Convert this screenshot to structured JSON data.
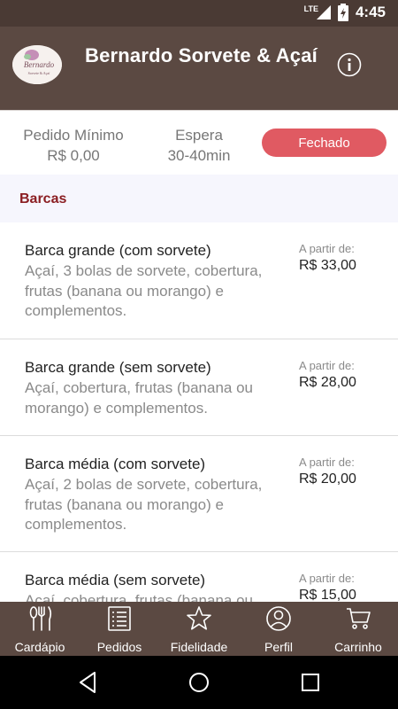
{
  "status_bar": {
    "network": "LTE",
    "time": "4:45"
  },
  "header": {
    "title": "Bernardo Sorvete & Açaí",
    "logo": {
      "name": "Bernardo",
      "sub": "Sorvete & Açaí"
    }
  },
  "info": {
    "min_order_label": "Pedido Mínimo",
    "min_order_value": "R$ 0,00",
    "wait_label": "Espera",
    "wait_value": "30-40min",
    "status": "Fechado"
  },
  "section": {
    "title": "Barcas"
  },
  "items": [
    {
      "name": "Barca grande (com sorvete)",
      "desc": "Açaí, 3 bolas de sorvete, cobertura, frutas (banana ou morango) e complementos.",
      "from": "A partir de:",
      "price": "R$ 33,00"
    },
    {
      "name": "Barca grande (sem sorvete)",
      "desc": "Açaí, cobertura, frutas (banana ou morango) e complementos.",
      "from": "A partir de:",
      "price": "R$ 28,00"
    },
    {
      "name": "Barca média (com sorvete)",
      "desc": "Açaí, 2 bolas de sorvete, cobertura, frutas (banana ou morango) e complementos.",
      "from": "A partir de:",
      "price": "R$ 20,00"
    },
    {
      "name": "Barca média (sem sorvete)",
      "desc": "Açaí, cobertura, frutas (banana ou morango) e complementos.",
      "from": "A partir de:",
      "price": "R$ 15,00"
    }
  ],
  "bottom_nav": [
    {
      "label": "Cardápio",
      "icon": "cutlery-icon"
    },
    {
      "label": "Pedidos",
      "icon": "list-icon"
    },
    {
      "label": "Fidelidade",
      "icon": "star-icon"
    },
    {
      "label": "Perfil",
      "icon": "user-icon"
    },
    {
      "label": "Carrinho",
      "icon": "cart-icon"
    }
  ],
  "colors": {
    "app_bar": "#5b4942",
    "status_bar": "#4a3a34",
    "closed_badge": "#e05a62",
    "section_title": "#8b1e22"
  }
}
